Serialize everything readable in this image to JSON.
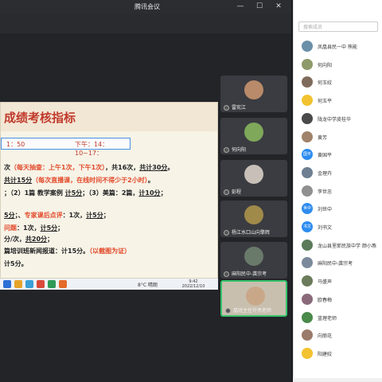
{
  "app": {
    "title": "腾讯会议"
  },
  "slide": {
    "title": "成绩考核指标",
    "time_left": "1：50",
    "time_right": "下午：14：10~17：",
    "lines": [
      [
        {
          "t": "次",
          "c": "b"
        },
        {
          "t": "（每天抽查：上午1次，下午1次）",
          "c": "red b"
        },
        {
          "t": "，共16次，",
          "c": "b"
        },
        {
          "t": "共计30分",
          "c": "b u"
        },
        {
          "t": "。",
          "c": "b"
        }
      ],
      [
        {
          "t": "共计15分",
          "c": "b u"
        },
        {
          "t": "（每次直播课，在线时间不得少于2小时）",
          "c": "red b"
        },
        {
          "t": "。",
          "c": "b"
        }
      ],
      [
        {
          "t": "；（2）1篇 教学案例 ",
          "c": "b"
        },
        {
          "t": "计5分",
          "c": "b u"
        },
        {
          "t": "；（3）美篇：2篇，",
          "c": "b"
        },
        {
          "t": "计10分",
          "c": "b u"
        },
        {
          "t": "；",
          "c": "b"
        }
      ],
      [
        {
          "t": "5分",
          "c": "b u"
        },
        {
          "t": "；、",
          "c": "b"
        },
        {
          "t": "专家课后点评",
          "c": "red b"
        },
        {
          "t": "：1次，",
          "c": "b"
        },
        {
          "t": "计5分",
          "c": "b u"
        },
        {
          "t": "；",
          "c": "b"
        }
      ],
      [
        {
          "t": "问题",
          "c": "red b"
        },
        {
          "t": "：1次，",
          "c": "b"
        },
        {
          "t": "计5分",
          "c": "b u"
        },
        {
          "t": "；",
          "c": "b"
        }
      ],
      [
        {
          "t": "分/次，",
          "c": "b"
        },
        {
          "t": "共20分",
          "c": "b u"
        },
        {
          "t": "；",
          "c": "b"
        }
      ],
      [
        {
          "t": "篇培训班新闻报道：计15分。",
          "c": "b"
        },
        {
          "t": "（以截图为证）",
          "c": "red b"
        }
      ],
      [
        {
          "t": "计5分。",
          "c": "b"
        }
      ]
    ]
  },
  "taskbar": {
    "weather": "8°C 晴朗",
    "time": "9:42",
    "date": "2022/12/10"
  },
  "videos": [
    {
      "name": "雷宪江"
    },
    {
      "name": "何向阳"
    },
    {
      "name": "彭程"
    },
    {
      "name": "杨江水口山向擎辉"
    },
    {
      "name": "麻阳民中-龚宗考"
    },
    {
      "name": "凰班主任许亮老师"
    }
  ],
  "panel": {
    "search_placeholder": "搜索成员",
    "participants": [
      {
        "name": "凤凰县民一中 熊能",
        "av": "#6b8fa8",
        "txt": ""
      },
      {
        "name": "何向阳",
        "av": "#8e9a6a",
        "txt": ""
      },
      {
        "name": "何玉姣",
        "av": "#7f6b5c",
        "txt": ""
      },
      {
        "name": "何玉平",
        "av": "#f2c230",
        "txt": ""
      },
      {
        "name": "陇龙中学皮桂华",
        "av": "#4a4a4a",
        "txt": ""
      },
      {
        "name": "黄芳",
        "av": "#a0836a",
        "txt": ""
      },
      {
        "name": "黄国平",
        "av": "#2d8cf0",
        "txt": "国平"
      },
      {
        "name": "金理卉",
        "av": "#6d7f91",
        "txt": ""
      },
      {
        "name": "李世忠",
        "av": "#909090",
        "txt": ""
      },
      {
        "name": "刘世中",
        "av": "#2d8cf0",
        "txt": "世中"
      },
      {
        "name": "刘书文",
        "av": "#2d8cf0",
        "txt": "书文"
      },
      {
        "name": "龙山县里耶民族中学 颜小燕",
        "av": "#5a7a5a",
        "txt": ""
      },
      {
        "name": "麻阳民中-龚宗考",
        "av": "#7a8a9a",
        "txt": ""
      },
      {
        "name": "马盛声",
        "av": "#6b7b5b",
        "txt": ""
      },
      {
        "name": "欧春梅",
        "av": "#8a6a7a",
        "txt": ""
      },
      {
        "name": "蓝理老师",
        "av": "#4a8a4a",
        "txt": ""
      },
      {
        "name": "向丽花",
        "av": "#9a7a6a",
        "txt": ""
      },
      {
        "name": "阳建姣",
        "av": "#f2c230",
        "txt": ""
      }
    ]
  }
}
